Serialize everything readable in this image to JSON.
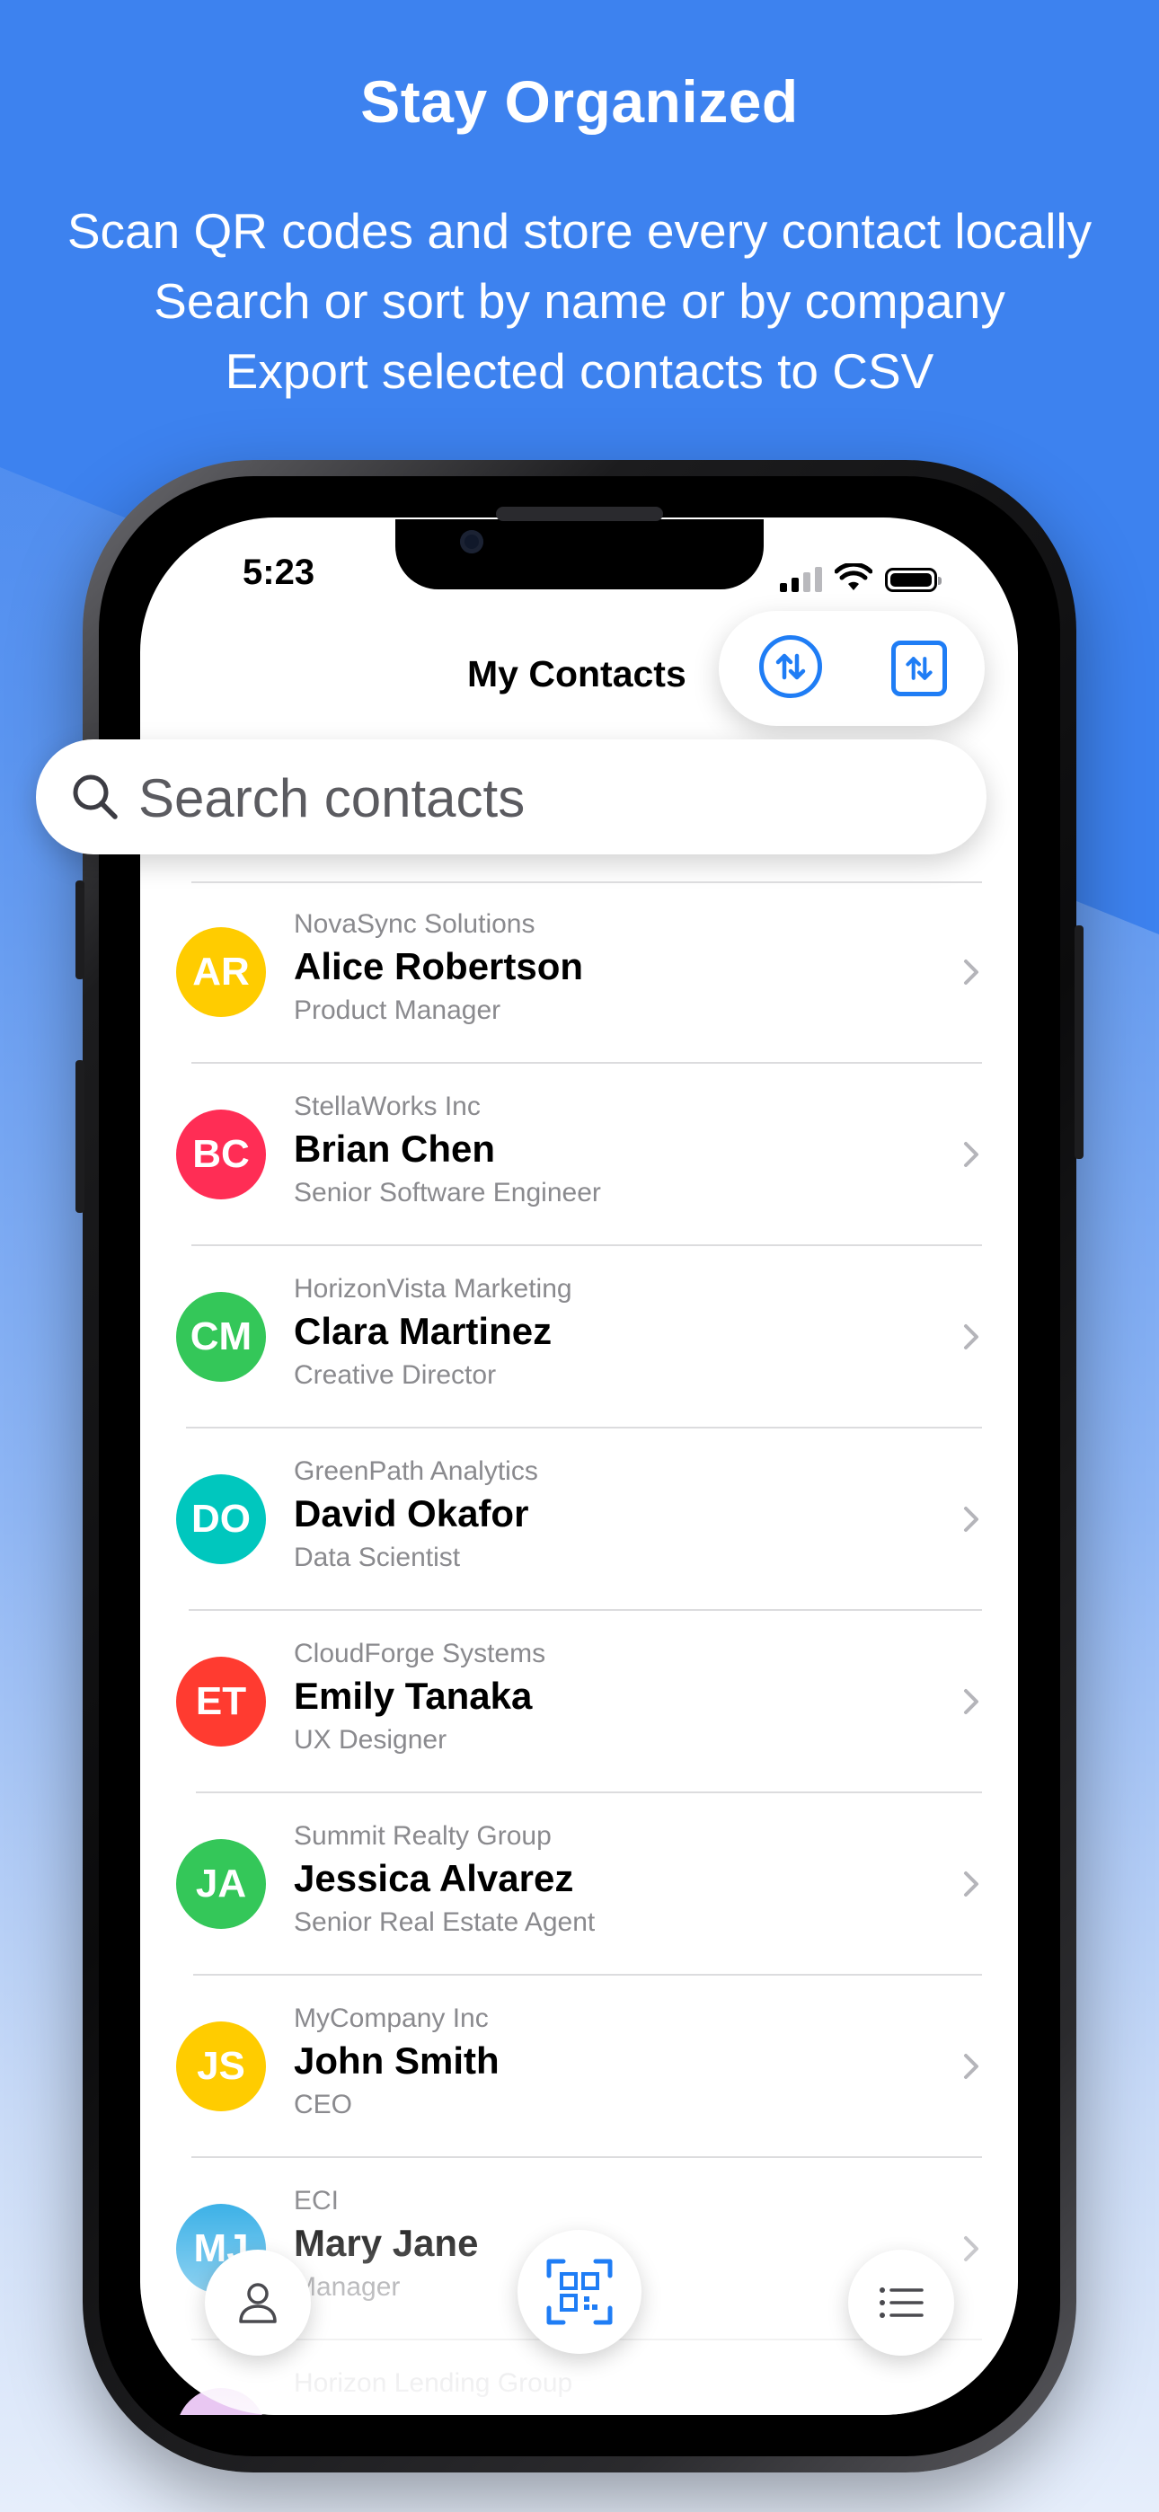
{
  "promo": {
    "headline": "Stay Organized",
    "lines": [
      "Scan QR codes and store every contact locally",
      "Search or sort by name or by company",
      "Export selected contacts to CSV"
    ]
  },
  "status_bar": {
    "time": "5:23"
  },
  "header": {
    "title": "My Contacts"
  },
  "search": {
    "placeholder": "Search contacts"
  },
  "contacts": [
    {
      "initials": "AR",
      "company": "NovaSync Solutions",
      "name": "Alice Robertson",
      "role": "Product Manager",
      "color": "#ffcc00"
    },
    {
      "initials": "BC",
      "company": "StellaWorks Inc",
      "name": "Brian Chen",
      "role": "Senior Software Engineer",
      "color": "#ff2d55"
    },
    {
      "initials": "CM",
      "company": "HorizonVista Marketing",
      "name": "Clara Martinez",
      "role": "Creative Director",
      "color": "#34c759"
    },
    {
      "initials": "DO",
      "company": "GreenPath Analytics",
      "name": "David Okafor",
      "role": "Data Scientist",
      "color": "#00c7be"
    },
    {
      "initials": "ET",
      "company": "CloudForge Systems",
      "name": "Emily Tanaka",
      "role": "UX Designer",
      "color": "#ff3b30"
    },
    {
      "initials": "JA",
      "company": "Summit Realty Group",
      "name": "Jessica Alvarez",
      "role": "Senior Real Estate Agent",
      "color": "#34c759"
    },
    {
      "initials": "JS",
      "company": "MyCompany Inc",
      "name": "John Smith",
      "role": "CEO",
      "color": "#ffcc00"
    },
    {
      "initials": "MJ",
      "company": "ECI",
      "name": "Mary Jane",
      "role": "Manager",
      "color": "#32ade6"
    },
    {
      "initials": "",
      "company": "Horizon Lending Group",
      "name": "",
      "role": "",
      "color": "#e9c7f2"
    }
  ],
  "colors": {
    "accent": "#1f7df5",
    "banner": "#3d82ef"
  },
  "icons": {
    "sort_by_name": "arrow-up-down-circle-icon",
    "sort_by_company": "arrow-up-down-square-icon",
    "profile": "person-icon",
    "scan": "qr-code-scan-icon",
    "list": "list-icon"
  }
}
